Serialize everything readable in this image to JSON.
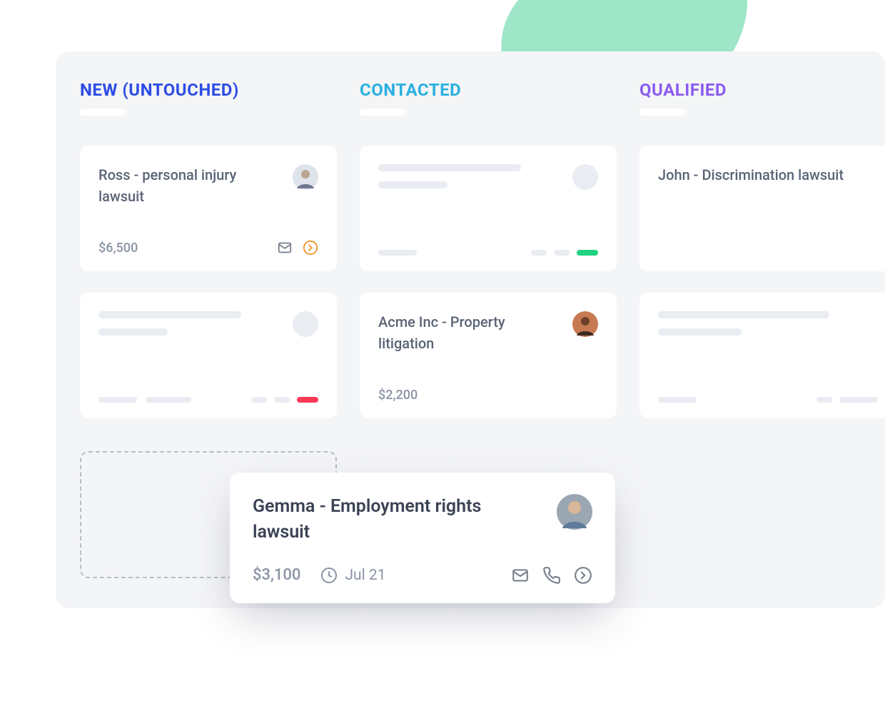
{
  "columns": {
    "new": {
      "title": "NEW (UNTOUCHED)"
    },
    "contacted": {
      "title": "CONTACTED"
    },
    "qualified": {
      "title": "QUALIFIED"
    }
  },
  "cards": {
    "ross": {
      "title": "Ross - personal injury lawsuit",
      "amount": "$6,500"
    },
    "acme": {
      "title": "Acme Inc - Property litigation",
      "amount": "$2,200"
    },
    "john": {
      "title": "John - Discrimination lawsuit"
    }
  },
  "dragCard": {
    "title": "Gemma - Employment rights lawsuit",
    "amount": "$3,100",
    "date": "Jul 21"
  },
  "colors": {
    "new": "#2e4de5",
    "contacted": "#2ab0e0",
    "qualified": "#8a5cf0",
    "statusGreen": "#1ed37f",
    "statusRed": "#ff3757",
    "actionOrange": "#f0952a"
  }
}
